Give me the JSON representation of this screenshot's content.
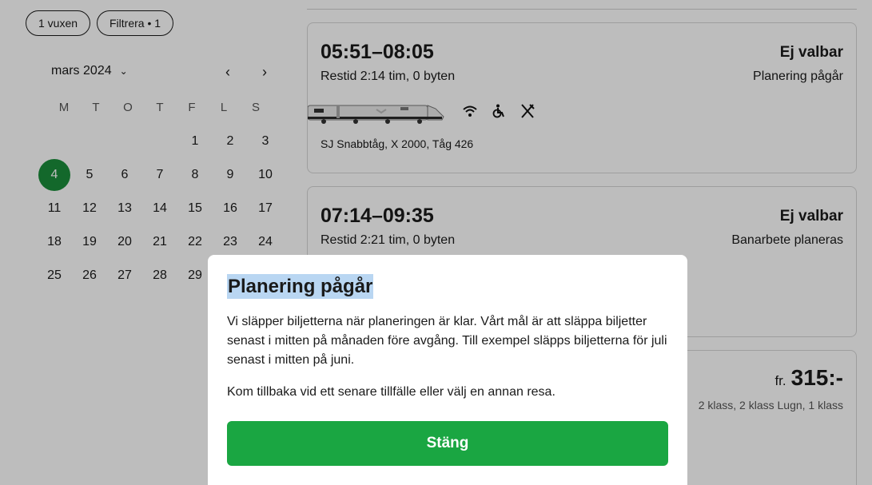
{
  "filters": {
    "passengers": "1 vuxen",
    "filter": "Filtrera • 1"
  },
  "calendar": {
    "month": "mars",
    "year": "2024",
    "weekdays": [
      "M",
      "T",
      "O",
      "T",
      "F",
      "L",
      "S"
    ],
    "selected_day": "4",
    "days": [
      "1",
      "2",
      "3",
      "4",
      "5",
      "6",
      "7",
      "8",
      "9",
      "10",
      "11",
      "12",
      "13",
      "14",
      "15",
      "16",
      "17",
      "18",
      "19",
      "20",
      "21",
      "22",
      "23",
      "24",
      "25",
      "26",
      "27",
      "28",
      "29"
    ]
  },
  "trips": [
    {
      "time": "05:51–08:05",
      "duration": "Restid 2:14 tim, 0 byten",
      "status": "Ej valbar",
      "note": "Planering pågår",
      "train_name": "SJ Snabbtåg, X 2000, Tåg 426",
      "amenities": [
        "wifi-icon",
        "wheelchair-icon",
        "restaurant-icon"
      ]
    },
    {
      "time": "07:14–09:35",
      "duration": "Restid 2:21 tim, 0 byten",
      "status": "Ej valbar",
      "note": "Banarbete planeras"
    },
    {
      "price_prefix": "fr.",
      "price": "315:-",
      "classes": "2 klass, 2 klass Lugn, 1 klass"
    }
  ],
  "modal": {
    "title": "Planering pågår",
    "paragraph1": "Vi släpper biljetterna när planeringen är klar. Vårt mål är att släppa biljetter senast i mitten på månaden före avgång. Till exempel släpps biljetterna för juli senast i mitten på juni.",
    "paragraph2": "Kom tillbaka vid ett senare tillfälle eller välj en annan resa.",
    "close_label": "Stäng"
  },
  "colors": {
    "accent": "#1aa642",
    "selected_day": "#1a8d3a",
    "highlight": "#b9d6f2"
  }
}
